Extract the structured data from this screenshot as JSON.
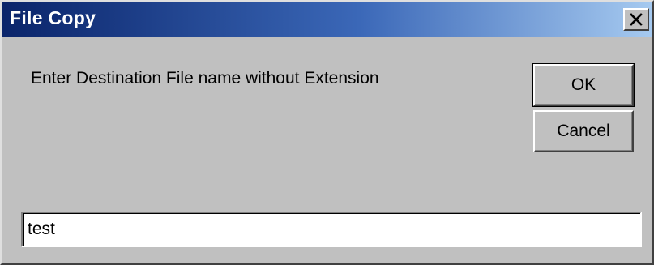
{
  "window": {
    "title": "File Copy"
  },
  "dialog": {
    "prompt": "Enter Destination File name without Extension",
    "ok_label": "OK",
    "cancel_label": "Cancel",
    "filename_value": "test"
  },
  "icons": {
    "close": "close-icon"
  },
  "colors": {
    "titlebar_start": "#0a246a",
    "titlebar_end": "#a6caf0",
    "face": "#c0c0c0"
  }
}
